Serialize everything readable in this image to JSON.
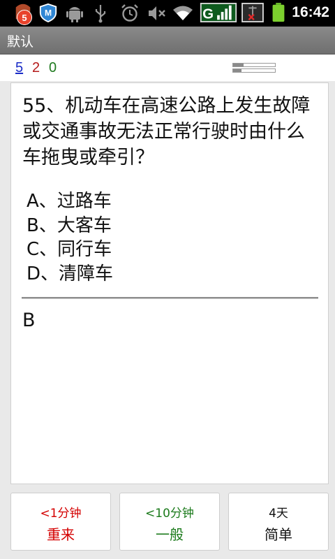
{
  "status_bar": {
    "notification_count": "5",
    "time": "16:42",
    "battery_level": 0.85,
    "icons": [
      "app-notification-icon",
      "shield-app-icon",
      "android-debug-icon",
      "usb-icon",
      "alarm-icon",
      "mute-icon",
      "wifi-icon",
      "gprs-signal-icon",
      "no-sim-signal-icon",
      "battery-icon"
    ]
  },
  "titlebar": {
    "title": "默认"
  },
  "counts": {
    "new": "5",
    "learning": "2",
    "review": "0"
  },
  "progress": {
    "session": 0.25,
    "deck": 0.2
  },
  "card": {
    "question": "55、机动车在高速公路上发生故障或交通事故无法正常行驶时由什么车拖曳或牵引？",
    "options": [
      "A、过路车",
      "B、大客车",
      "C、同行车",
      "D、清障车"
    ],
    "answer": "B"
  },
  "buttons": [
    {
      "interval": "<1分钟",
      "label": "重来",
      "color": "#d40000"
    },
    {
      "interval": "<10分钟",
      "label": "一般",
      "color": "#1b7a1b"
    },
    {
      "interval": "4天",
      "label": "简单",
      "color": "#111111"
    }
  ]
}
